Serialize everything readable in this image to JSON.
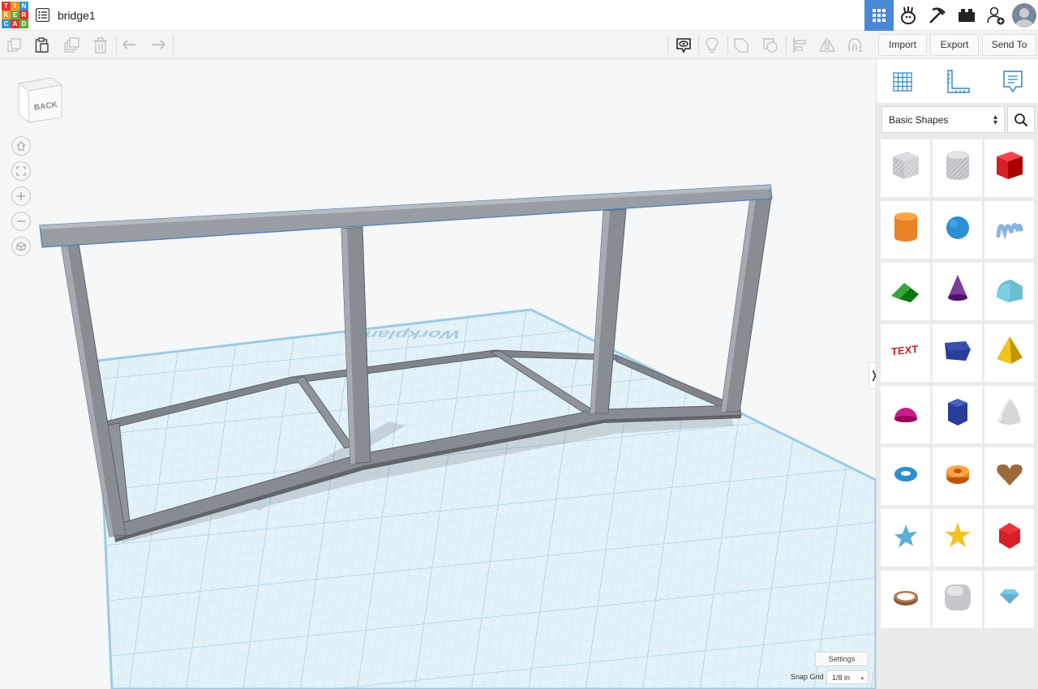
{
  "app": {
    "logo_letters": [
      "T",
      "I",
      "N",
      "K",
      "E",
      "R",
      "C",
      "A",
      "D"
    ],
    "logo_colors": [
      "#e2342b",
      "#f29727",
      "#2d97d1",
      "#f29727",
      "#5cae38",
      "#e2342b",
      "#2d97d1",
      "#e2342b",
      "#5cae38"
    ],
    "project_title": "bridge1"
  },
  "topbar": {
    "icons": [
      "grid-view-icon",
      "tinker-3d-icon",
      "pickaxe-icon",
      "brick-icon",
      "add-user-icon",
      "avatar"
    ],
    "active_color": "#4a88d6"
  },
  "toolbar": {
    "tools": [
      "copy",
      "paste",
      "duplicate",
      "delete",
      "undo",
      "redo",
      "notes",
      "show-all",
      "lightbulb",
      "solid",
      "hole",
      "align",
      "mirror",
      "group"
    ],
    "actions": [
      "Import",
      "Export",
      "Send To"
    ]
  },
  "workspace": {
    "viewcube_label": "BACK",
    "workplane_label": "Workplane",
    "settings_label": "Settings",
    "snap_grid_label": "Snap Grid",
    "snap_grid_value": "1/8 in",
    "collapse_glyph": "❭"
  },
  "panel": {
    "library_name": "Basic Shapes",
    "shapes": [
      {
        "name": "box-hole",
        "color": "#bdbfc3"
      },
      {
        "name": "cylinder-hole",
        "color": "#bdbfc3"
      },
      {
        "name": "box",
        "color": "#d61f26"
      },
      {
        "name": "cylinder",
        "color": "#ea8226"
      },
      {
        "name": "sphere",
        "color": "#2d8ed4"
      },
      {
        "name": "scribble",
        "color": "#8ab4e0"
      },
      {
        "name": "roof",
        "color": "#39a33c"
      },
      {
        "name": "cone",
        "color": "#7a3d9a"
      },
      {
        "name": "round-roof",
        "color": "#6bbfd0"
      },
      {
        "name": "text",
        "color": "#c0272d"
      },
      {
        "name": "polygon",
        "color": "#283e9a"
      },
      {
        "name": "pyramid",
        "color": "#f1c31c"
      },
      {
        "name": "half-sphere",
        "color": "#c81e8a"
      },
      {
        "name": "hexagonal-prism",
        "color": "#283e9a"
      },
      {
        "name": "paraboloid",
        "color": "#d8d8d8"
      },
      {
        "name": "torus",
        "color": "#2d8ed4"
      },
      {
        "name": "tube",
        "color": "#ea8226"
      },
      {
        "name": "heart",
        "color": "#9a6a3a"
      },
      {
        "name": "star",
        "color": "#5aaed8"
      },
      {
        "name": "star-yellow",
        "color": "#f1c31c"
      },
      {
        "name": "icosahedron",
        "color": "#d61f26"
      },
      {
        "name": "ring",
        "color": "#8b5a35"
      },
      {
        "name": "rounded-box",
        "color": "#c5c7ca"
      },
      {
        "name": "diamond",
        "color": "#7fc8e8"
      }
    ]
  }
}
